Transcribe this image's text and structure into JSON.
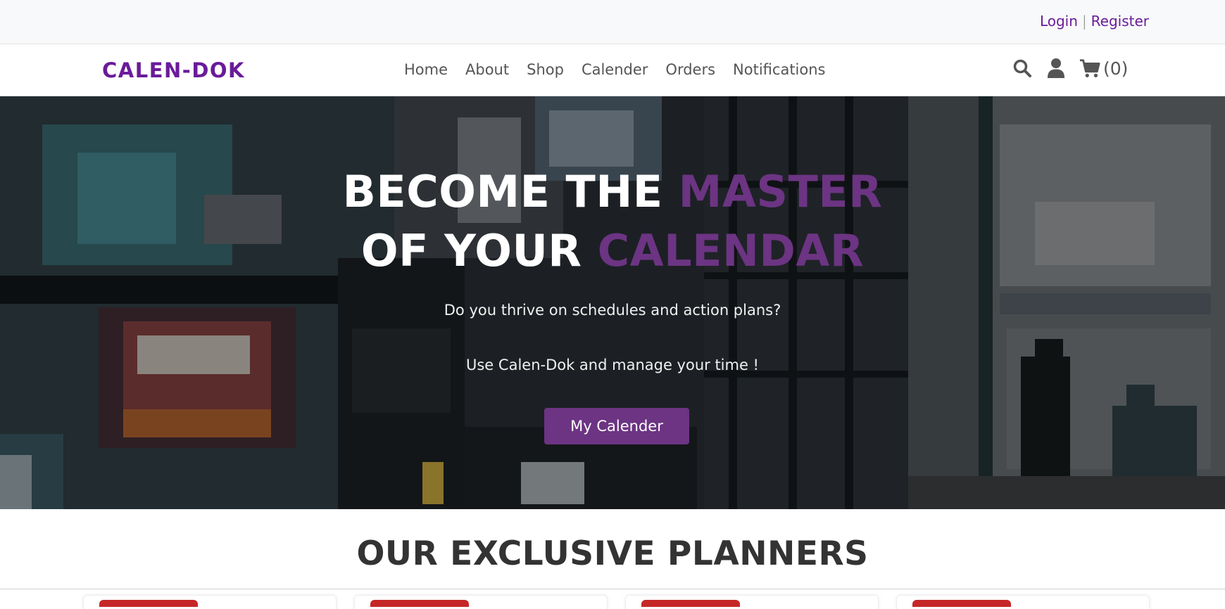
{
  "auth": {
    "login": "Login",
    "separator": "|",
    "register": "Register"
  },
  "brand": "CALEN-DOK",
  "nav": {
    "links": [
      "Home",
      "About",
      "Shop",
      "Calender",
      "Orders",
      "Notifications"
    ],
    "cart_count": "(0)",
    "icons": [
      "search-icon",
      "user-icon",
      "cart-icon"
    ]
  },
  "hero": {
    "line1_white": "BECOME THE ",
    "line1_accent": "MASTER",
    "line2_white": "OF YOUR ",
    "line2_accent": "CALENDAR",
    "subtitle1": "Do you thrive on schedules and action plans?",
    "subtitle2": "Use Calen-Dok and manage your time !",
    "button": "My Calender"
  },
  "section": {
    "title": "OUR EXCLUSIVE PLANNERS"
  },
  "colors": {
    "accent": "#6a1b9a",
    "button": "#6c3483",
    "tag": "#c62828"
  }
}
